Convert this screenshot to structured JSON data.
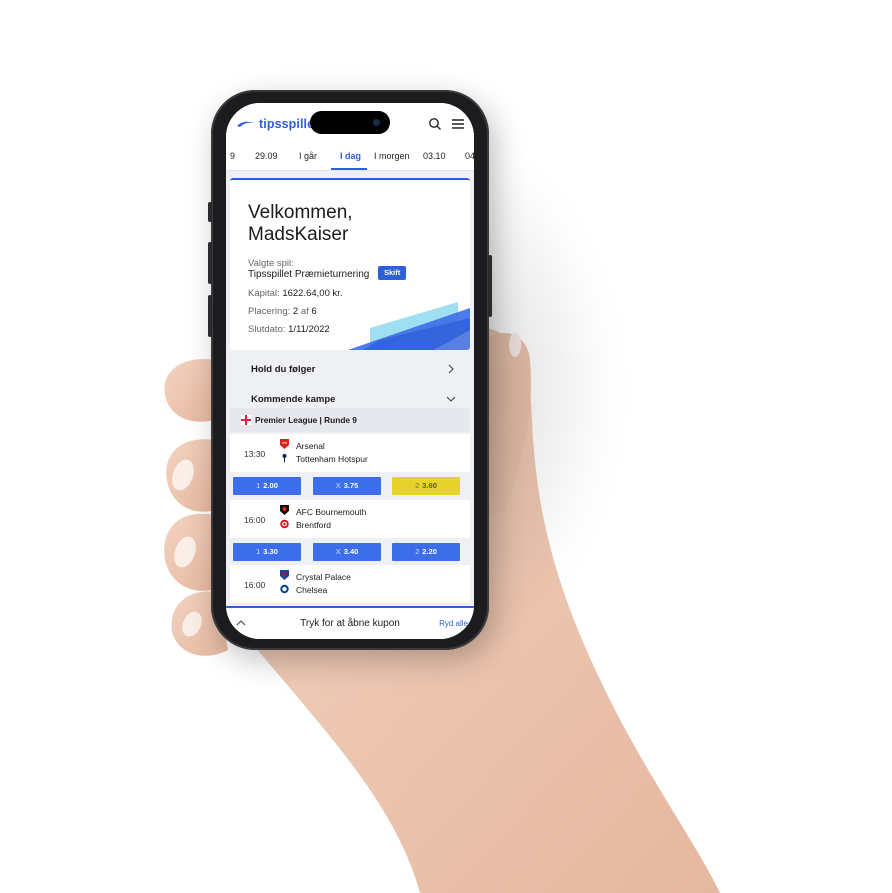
{
  "header": {
    "logo_text": "tipsspillet"
  },
  "dates": {
    "items": [
      "9",
      "29.09",
      "I går",
      "I dag",
      "I morgen",
      "03.10",
      "04"
    ],
    "active_index": 3
  },
  "welcome": {
    "title": "Velkommen, MadsKaiser",
    "selected_game_label": "Valgte spil:",
    "selected_game": "Tipsspillet Præmieturnering",
    "switch_button": "Skift",
    "capital_label": "Kapital:",
    "capital_value": "1622.64,00 kr.",
    "placement_label": "Placering:",
    "placement_value": "2",
    "placement_of": "af",
    "placement_total": "6",
    "end_date_label": "Slutdato:",
    "end_date_value": "1/11/2022"
  },
  "sections": {
    "following": "Hold du følger",
    "upcoming": "Kommende kampe"
  },
  "league": {
    "name": "Premier League | Runde 9"
  },
  "matches": [
    {
      "time": "13:30",
      "home": "Arsenal",
      "away": "Tottenham Hotspur",
      "odds": [
        {
          "key": "1",
          "value": "2.00"
        },
        {
          "key": "X",
          "value": "3.75"
        },
        {
          "key": "2",
          "value": "3.60"
        }
      ],
      "selected_index": 2
    },
    {
      "time": "16:00",
      "home": "AFC Bournemouth",
      "away": "Brentford",
      "odds": [
        {
          "key": "1",
          "value": "3.30"
        },
        {
          "key": "X",
          "value": "3.40"
        },
        {
          "key": "2",
          "value": "2.20"
        }
      ],
      "selected_index": -1
    },
    {
      "time": "16:00",
      "home": "Crystal Palace",
      "away": "Chelsea",
      "odds": [
        {
          "key": "1",
          "value": ""
        },
        {
          "key": "X",
          "value": ""
        },
        {
          "key": "2",
          "value": ""
        }
      ],
      "selected_index": -1
    }
  ],
  "coupon": {
    "open_text": "Tryk for at åbne kupon",
    "clear_all": "Ryd alle"
  },
  "colors": {
    "brand": "#2f5fd8",
    "odd": "#3b6ee8",
    "selected": "#e7d22a"
  },
  "icons": [
    "search-icon",
    "menu-icon",
    "chevron-right-icon",
    "chevron-down-icon",
    "chevron-up-icon",
    "england-flag-icon"
  ]
}
